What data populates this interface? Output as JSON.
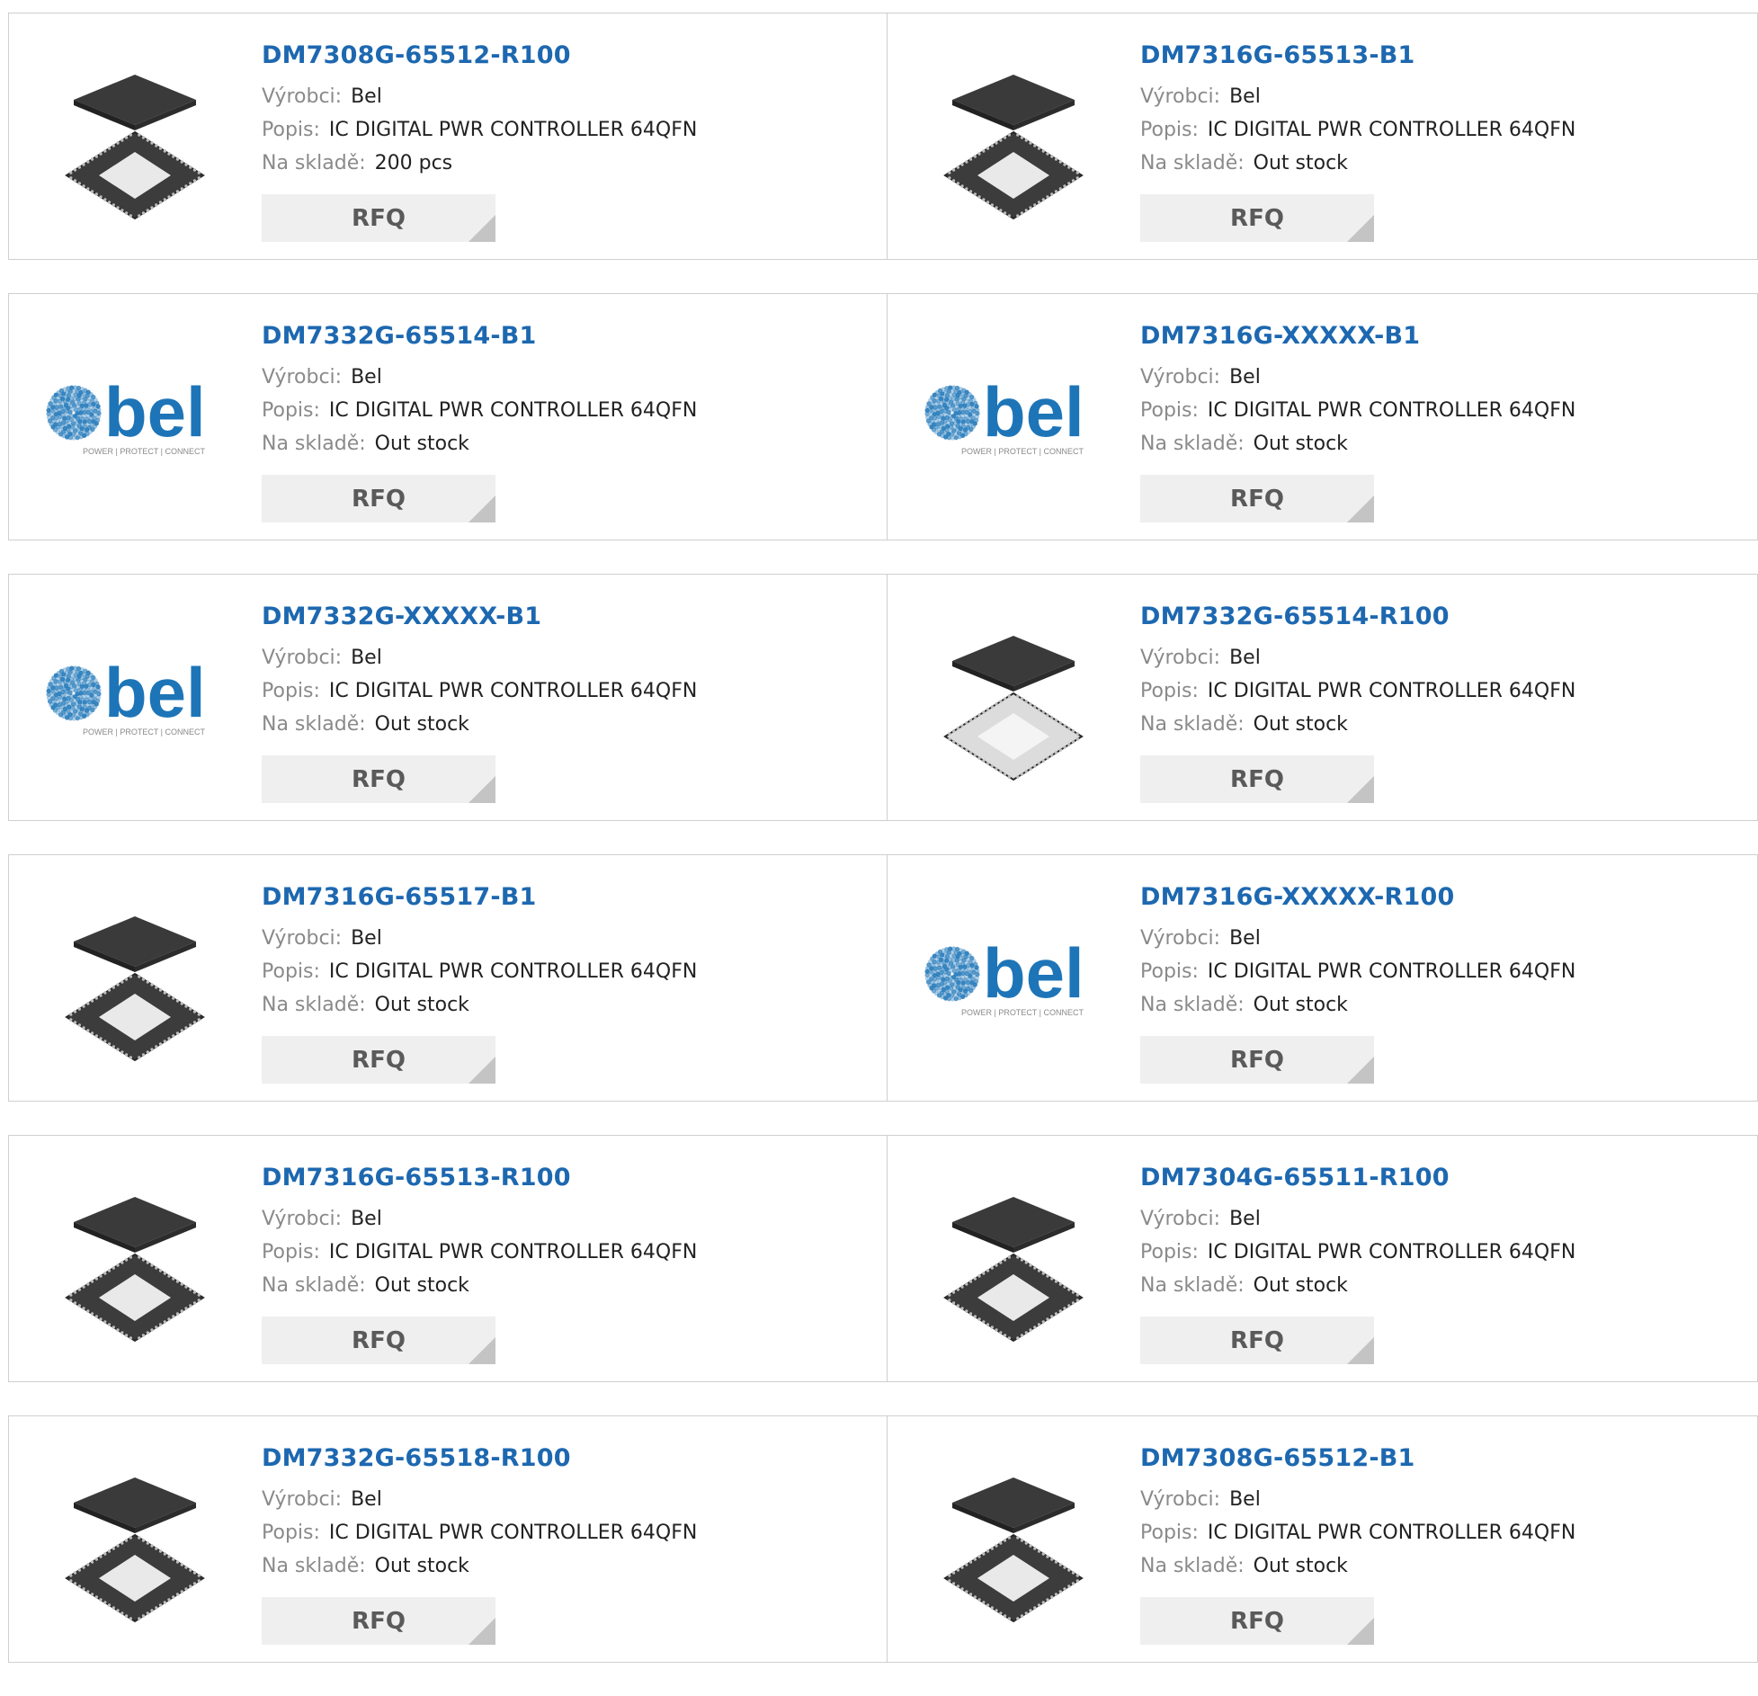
{
  "labels": {
    "manufacturer": "Výrobci:",
    "description": "Popis:",
    "stock": "Na skladě:",
    "rfq": "RFQ"
  },
  "logo": {
    "wordmark": "bel",
    "tagline": "POWER | PROTECT | CONNECT",
    "brand_color": "#1d75b8"
  },
  "colors": {
    "title": "#1d68b0",
    "label": "#8a8a8a",
    "button_bg": "#efefef"
  },
  "products": [
    {
      "part": "DM7308G-65512-R100",
      "manufacturer": "Bel",
      "description": "IC DIGITAL PWR CONTROLLER 64QFN",
      "stock": "200 pcs",
      "image": "chip"
    },
    {
      "part": "DM7316G-65513-B1",
      "manufacturer": "Bel",
      "description": "IC DIGITAL PWR CONTROLLER 64QFN",
      "stock": "Out stock",
      "image": "chip"
    },
    {
      "part": "DM7332G-65514-B1",
      "manufacturer": "Bel",
      "description": "IC DIGITAL PWR CONTROLLER 64QFN",
      "stock": "Out stock",
      "image": "logo"
    },
    {
      "part": "DM7316G-XXXXX-B1",
      "manufacturer": "Bel",
      "description": "IC DIGITAL PWR CONTROLLER 64QFN",
      "stock": "Out stock",
      "image": "logo"
    },
    {
      "part": "DM7332G-XXXXX-B1",
      "manufacturer": "Bel",
      "description": "IC DIGITAL PWR CONTROLLER 64QFN",
      "stock": "Out stock",
      "image": "logo"
    },
    {
      "part": "DM7332G-65514-R100",
      "manufacturer": "Bel",
      "description": "IC DIGITAL PWR CONTROLLER 64QFN",
      "stock": "Out stock",
      "image": "chip-light"
    },
    {
      "part": "DM7316G-65517-B1",
      "manufacturer": "Bel",
      "description": "IC DIGITAL PWR CONTROLLER 64QFN",
      "stock": "Out stock",
      "image": "chip"
    },
    {
      "part": "DM7316G-XXXXX-R100",
      "manufacturer": "Bel",
      "description": "IC DIGITAL PWR CONTROLLER 64QFN",
      "stock": "Out stock",
      "image": "logo"
    },
    {
      "part": "DM7316G-65513-R100",
      "manufacturer": "Bel",
      "description": "IC DIGITAL PWR CONTROLLER 64QFN",
      "stock": "Out stock",
      "image": "chip"
    },
    {
      "part": "DM7304G-65511-R100",
      "manufacturer": "Bel",
      "description": "IC DIGITAL PWR CONTROLLER 64QFN",
      "stock": "Out stock",
      "image": "chip"
    },
    {
      "part": "DM7332G-65518-R100",
      "manufacturer": "Bel",
      "description": "IC DIGITAL PWR CONTROLLER 64QFN",
      "stock": "Out stock",
      "image": "chip"
    },
    {
      "part": "DM7308G-65512-B1",
      "manufacturer": "Bel",
      "description": "IC DIGITAL PWR CONTROLLER 64QFN",
      "stock": "Out stock",
      "image": "chip"
    }
  ]
}
